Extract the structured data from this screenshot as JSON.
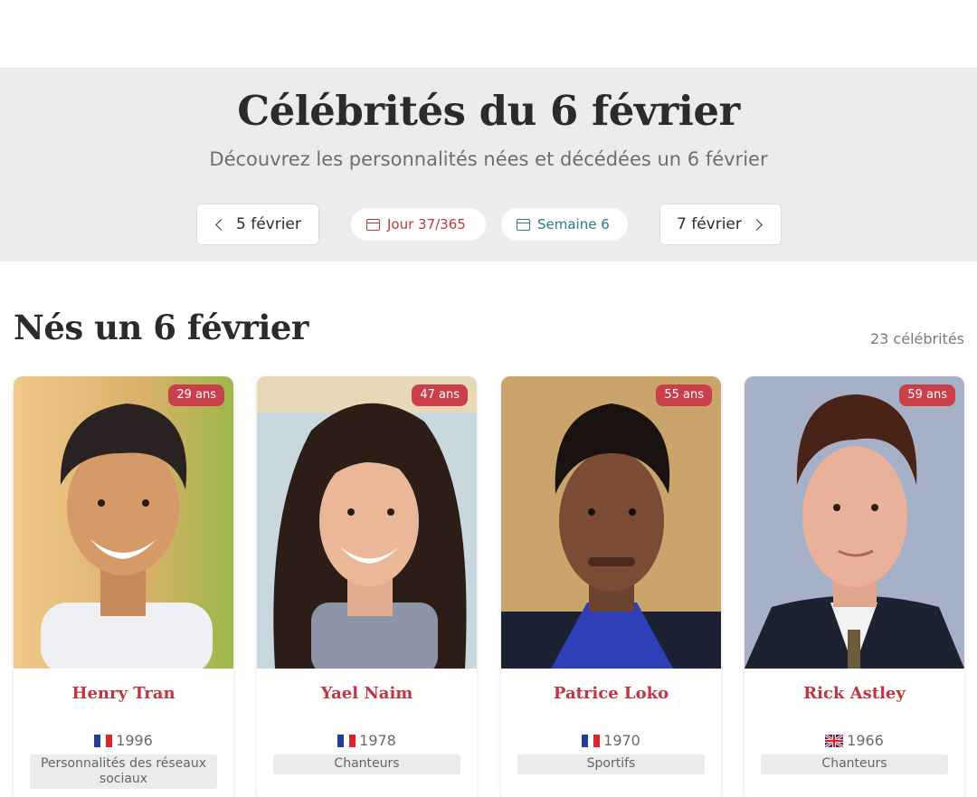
{
  "hero": {
    "title": "Célébrités du 6 février",
    "subtitle": "Découvrez les personnalités nées et décédées un 6 février",
    "prev_label": "5 février",
    "next_label": "7 février",
    "day_label": "Jour 37/365",
    "week_label": "Semaine 6"
  },
  "section": {
    "title": "Nés un 6 février",
    "count": "23 célébrités"
  },
  "colors": {
    "accent": "#c0353f",
    "week": "#2a7a87",
    "hero_bg": "#ececec"
  },
  "cards": [
    {
      "age": "29 ans",
      "name": "Henry Tran",
      "flag": "fr-flag-icon",
      "year": "1996",
      "tag": "Personnalités des réseaux sociaux"
    },
    {
      "age": "47 ans",
      "name": "Yael Naim",
      "flag": "fr-flag-icon",
      "year": "1978",
      "tag": "Chanteurs"
    },
    {
      "age": "55 ans",
      "name": "Patrice Loko",
      "flag": "fr-flag-icon",
      "year": "1970",
      "tag": "Sportifs"
    },
    {
      "age": "59 ans",
      "name": "Rick Astley",
      "flag": "uk-flag-icon",
      "year": "1966",
      "tag": "Chanteurs"
    }
  ]
}
